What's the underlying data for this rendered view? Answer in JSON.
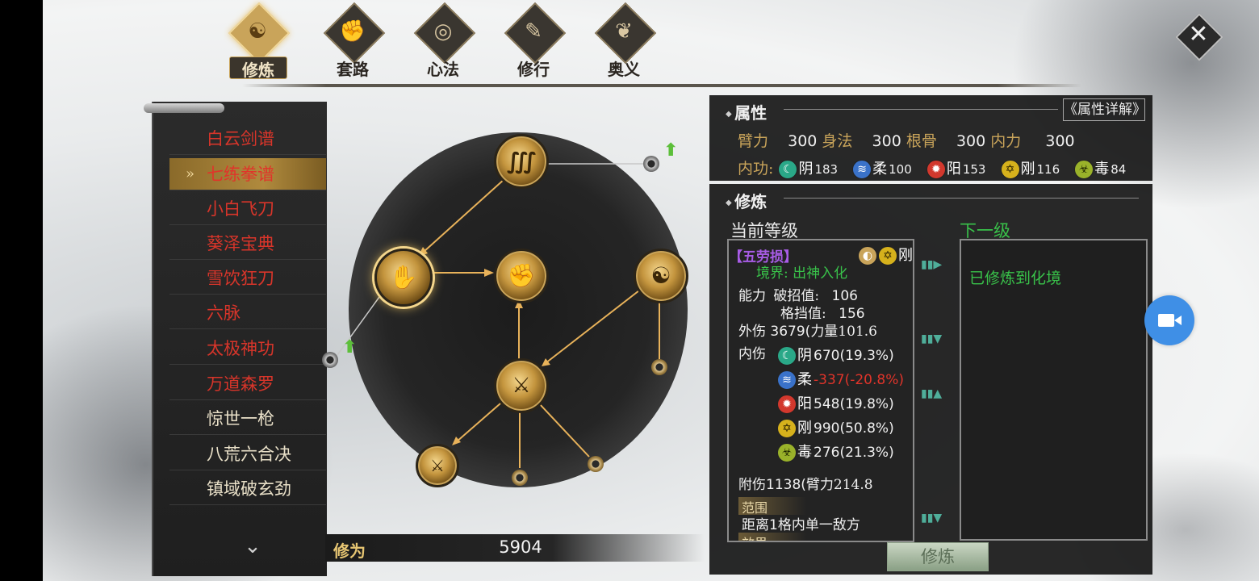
{
  "tabs": [
    {
      "label": "修炼",
      "icon": "flame-icon",
      "glyph": "☯",
      "active": true
    },
    {
      "label": "套路",
      "icon": "fist-icon",
      "glyph": "✊",
      "active": false
    },
    {
      "label": "心法",
      "icon": "swirl-icon",
      "glyph": "◎",
      "active": false
    },
    {
      "label": "修行",
      "icon": "scroll-icon",
      "glyph": "✎",
      "active": false
    },
    {
      "label": "奥义",
      "icon": "crest-icon",
      "glyph": "❦",
      "active": false
    }
  ],
  "close_glyph": "✕",
  "skill_list": [
    {
      "label": "白云剑谱",
      "color": "red"
    },
    {
      "label": "七练拳谱",
      "color": "red",
      "selected": true
    },
    {
      "label": "小白飞刀",
      "color": "red"
    },
    {
      "label": "葵泽宝典",
      "color": "red"
    },
    {
      "label": "雪饮狂刀",
      "color": "red"
    },
    {
      "label": "六脉",
      "color": "red"
    },
    {
      "label": "太极神功",
      "color": "red"
    },
    {
      "label": "万道森罗",
      "color": "red"
    },
    {
      "label": "惊世一枪",
      "color": "cream"
    },
    {
      "label": "八荒六合决",
      "color": "cream"
    },
    {
      "label": "镇域破玄劲",
      "color": "cream"
    }
  ],
  "selected_arrow": "»",
  "scroll_down_glyph": "⌄",
  "xiuwei": {
    "label": "修为",
    "value": "5904"
  },
  "attributes": {
    "title": "属性",
    "detail_button": "《属性详解》",
    "rows": [
      {
        "label": "臂力",
        "value": "300"
      },
      {
        "label": "身法",
        "value": "300"
      },
      {
        "label": "根骨",
        "value": "300"
      },
      {
        "label": "内力",
        "value": "300"
      }
    ],
    "neigong_label": "内功:",
    "neigong": [
      {
        "label": "阴",
        "value": "183",
        "cls": "c-yin",
        "icon": "yin-icon"
      },
      {
        "label": "柔",
        "value": "100",
        "cls": "c-rou",
        "icon": "rou-icon"
      },
      {
        "label": "阳",
        "value": "153",
        "cls": "c-yang",
        "icon": "yang-icon"
      },
      {
        "label": "刚",
        "value": "116",
        "cls": "c-gang",
        "icon": "gang-icon"
      },
      {
        "label": "毒",
        "value": "84",
        "cls": "c-du",
        "icon": "du-icon"
      }
    ]
  },
  "cultivation": {
    "title": "修炼",
    "current_level_label": "当前等级",
    "next_level_label": "下一级",
    "skill_name": "【五劳损】",
    "skill_tag": "刚",
    "realm_label": "境界:",
    "realm_value": "出神入化",
    "ability_label": "能力",
    "break_label": "破招值:",
    "break_value": "106",
    "block_label": "格挡值:",
    "block_value": "156",
    "outer_label": "外伤",
    "outer_value": "3679(",
    "outer_attr": "力量101.6",
    "inner_label": "内伤",
    "inner": [
      {
        "label": "阴",
        "value": "670(19.3%)",
        "cls": "c-yin",
        "neg": false
      },
      {
        "label": "柔",
        "value": "-337(-20.8%)",
        "cls": "c-rou",
        "neg": true
      },
      {
        "label": "阳",
        "value": "548(19.8%)",
        "cls": "c-yang",
        "neg": false
      },
      {
        "label": "刚",
        "value": "990(50.8%)",
        "cls": "c-gang",
        "neg": false
      },
      {
        "label": "毒",
        "value": "276(21.3%)",
        "cls": "c-du",
        "neg": false
      }
    ],
    "extra_label": "附伤",
    "extra_value": "1138(",
    "extra_attr": "臂力214.8",
    "range_tag": "范围",
    "range_text": "距离1格内单一敌方",
    "effect_tag": "效果",
    "next_text": "已修炼到化境",
    "cultivate_button": "修炼"
  },
  "tree_nodes": [
    {
      "name": "node-top",
      "glyph": "∭"
    },
    {
      "name": "node-left-selected",
      "glyph": "✋"
    },
    {
      "name": "node-center",
      "glyph": "✊"
    },
    {
      "name": "node-right",
      "glyph": "☯"
    },
    {
      "name": "node-lower-center",
      "glyph": "⚔"
    },
    {
      "name": "node-bottom-left",
      "glyph": "⚔"
    }
  ],
  "up_arrow_glyph": "⬆",
  "colors": {
    "accent_gold": "#c9a45a",
    "red_text": "#d8352a",
    "green_text": "#39c24a",
    "purple_text": "#a85ce6",
    "camera_blue": "#3f8fe6"
  }
}
